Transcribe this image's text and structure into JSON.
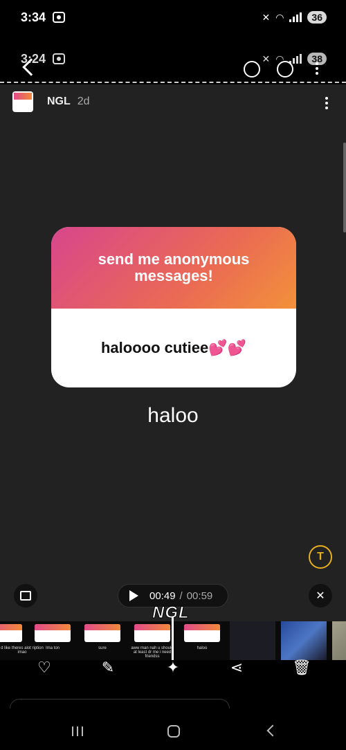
{
  "status_bar_top": {
    "time": "3:34",
    "battery": "36"
  },
  "status_bar_inner": {
    "time": "3:24",
    "battery": "38"
  },
  "story": {
    "username": "NGL",
    "age": "2d"
  },
  "card": {
    "prompt": "send me anonymous messages!",
    "message": "haloooo cutiee💕💕"
  },
  "caption": "haloo",
  "player": {
    "current": "00:49",
    "separator": "/",
    "total": "00:59"
  },
  "watermark": "NGL",
  "thumbnails": [
    {
      "caption": "d like theres alot ription imao"
    },
    {
      "caption": "Ima ton"
    },
    {
      "caption": "sure"
    },
    {
      "caption": "aww man nah u should at least dr me i need friendss"
    },
    {
      "caption": "haloo"
    }
  ],
  "colors": {
    "card_gradient_start": "#d8468c",
    "card_gradient_end": "#f2913a",
    "accent_yellow": "#e8b020",
    "panel_bg": "#222222"
  }
}
